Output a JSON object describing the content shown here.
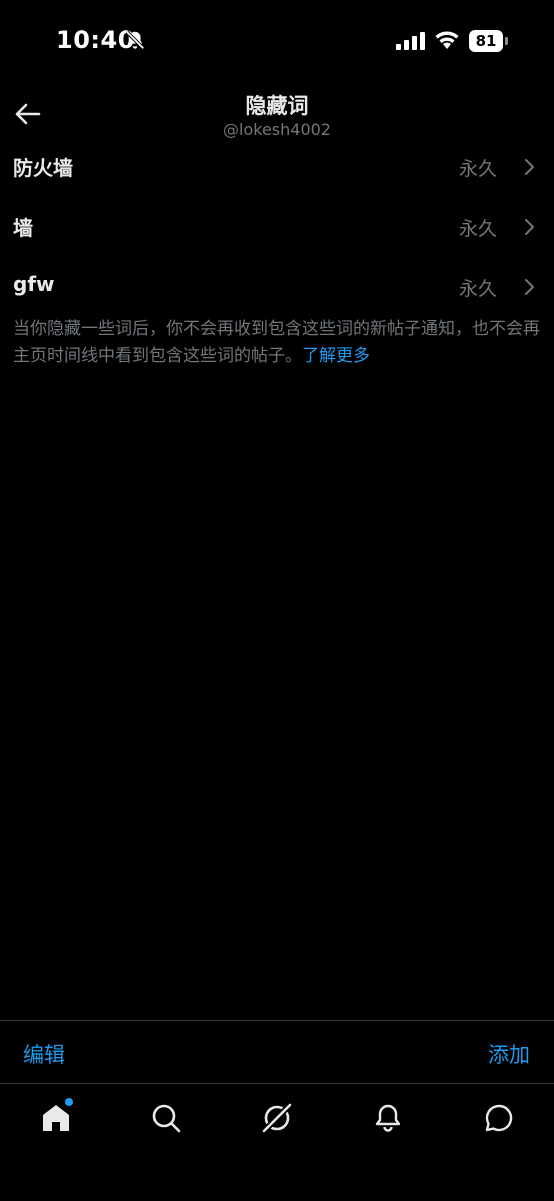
{
  "status_bar": {
    "time": "10:40",
    "battery": "81"
  },
  "header": {
    "title": "隐藏词",
    "subtitle": "@lokesh4002"
  },
  "muted_words": [
    {
      "word": "防火墙",
      "duration": "永久"
    },
    {
      "word": "墙",
      "duration": "永久"
    },
    {
      "word": "gfw",
      "duration": "永久"
    }
  ],
  "info": {
    "text": "当你隐藏一些词后，你不会再收到包含这些词的新帖子通知，也不会再主页时间线中看到包含这些词的帖子。",
    "link": "了解更多"
  },
  "toolbar": {
    "edit_label": "编辑",
    "add_label": "添加"
  },
  "tabs": [
    {
      "icon": "home-icon",
      "active": true,
      "has_dot": true
    },
    {
      "icon": "search-icon",
      "active": false
    },
    {
      "icon": "grok-icon",
      "active": false
    },
    {
      "icon": "bell-icon",
      "active": false
    },
    {
      "icon": "messages-icon",
      "active": false
    }
  ],
  "colors": {
    "background": "#000000",
    "text_primary": "#e7e9ea",
    "text_secondary": "#71767b",
    "accent": "#1d9bf0",
    "divider": "#2f3336"
  }
}
